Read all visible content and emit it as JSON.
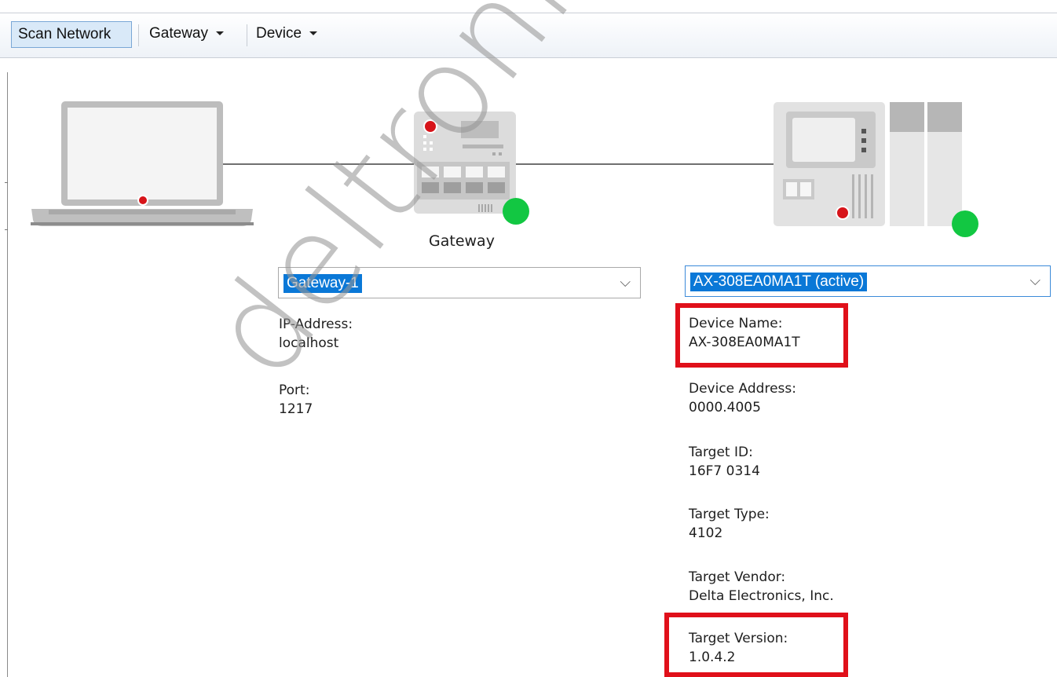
{
  "toolbar": {
    "scan_network": "Scan Network",
    "gateway_menu": "Gateway",
    "device_menu": "Device"
  },
  "gateway": {
    "caption": "Gateway",
    "selected": "Gateway-1",
    "ip_label": "IP-Address:",
    "ip_value": "localhost",
    "port_label": "Port:",
    "port_value": "1217"
  },
  "device": {
    "selected": "AX-308EA0MA1T (active)",
    "fields": [
      {
        "label": "Device Name:",
        "value": "AX-308EA0MA1T"
      },
      {
        "label": "Device Address:",
        "value": "0000.4005"
      },
      {
        "label": "Target ID:",
        "value": "16F7 0314"
      },
      {
        "label": "Target Type:",
        "value": "4102"
      },
      {
        "label": "Target Vendor:",
        "value": "Delta Electronics, Inc."
      },
      {
        "label": "Target Version:",
        "value": "1.0.4.2"
      }
    ]
  },
  "status": {
    "online_color": "#12c742",
    "highlight_color": "#e0101a"
  },
  "watermark": "deltronics.ru"
}
